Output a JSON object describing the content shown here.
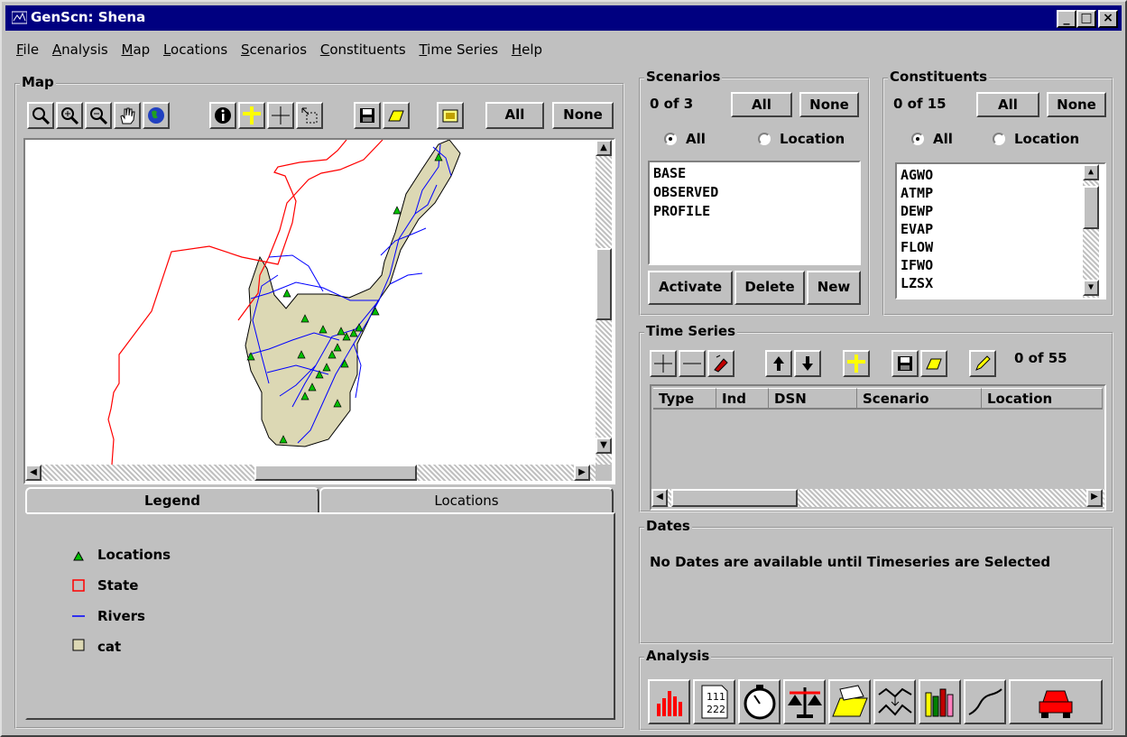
{
  "window": {
    "title": "GenScn: Shena",
    "min": "_",
    "max": "□",
    "close": "×"
  },
  "menu": [
    "File",
    "Analysis",
    "Map",
    "Locations",
    "Scenarios",
    "Constituents",
    "Time Series",
    "Help"
  ],
  "map": {
    "label": "Map",
    "all_label": "All",
    "none_label": "None",
    "tabs": {
      "legend": "Legend",
      "locations": "Locations"
    },
    "legend": [
      {
        "label": "Locations",
        "symbol": "triangle",
        "color": "#00c000"
      },
      {
        "label": "State",
        "symbol": "square",
        "color": "#ff0000"
      },
      {
        "label": "Rivers",
        "symbol": "line",
        "color": "#0000ff"
      },
      {
        "label": "cat",
        "symbol": "square",
        "color": "#dcd8b4"
      }
    ]
  },
  "scenarios": {
    "label": "Scenarios",
    "count": "0 of 3",
    "all_label": "All",
    "none_label": "None",
    "radio_all": "All",
    "radio_location": "Location",
    "items": [
      "BASE",
      "OBSERVED",
      "PROFILE"
    ],
    "activate": "Activate",
    "delete": "Delete",
    "new": "New"
  },
  "constituents": {
    "label": "Constituents",
    "count": "0 of 15",
    "all_label": "All",
    "none_label": "None",
    "radio_all": "All",
    "radio_location": "Location",
    "items": [
      "AGWO",
      "ATMP",
      "DEWP",
      "EVAP",
      "FLOW",
      "IFWO",
      "LZSX"
    ]
  },
  "timeseries": {
    "label": "Time Series",
    "count": "0 of 55",
    "columns": [
      "Type",
      "Ind",
      "DSN",
      "Scenario",
      "Location"
    ]
  },
  "dates": {
    "label": "Dates",
    "message": "No Dates are available until Timeseries are Selected"
  },
  "analysis": {
    "label": "Analysis"
  },
  "colors": {
    "titlebar": "#000080",
    "face": "#c0c0c0",
    "state": "#ff0000",
    "rivers": "#0000ff",
    "catchment": "#dcd8b4",
    "locations": "#00c000"
  }
}
